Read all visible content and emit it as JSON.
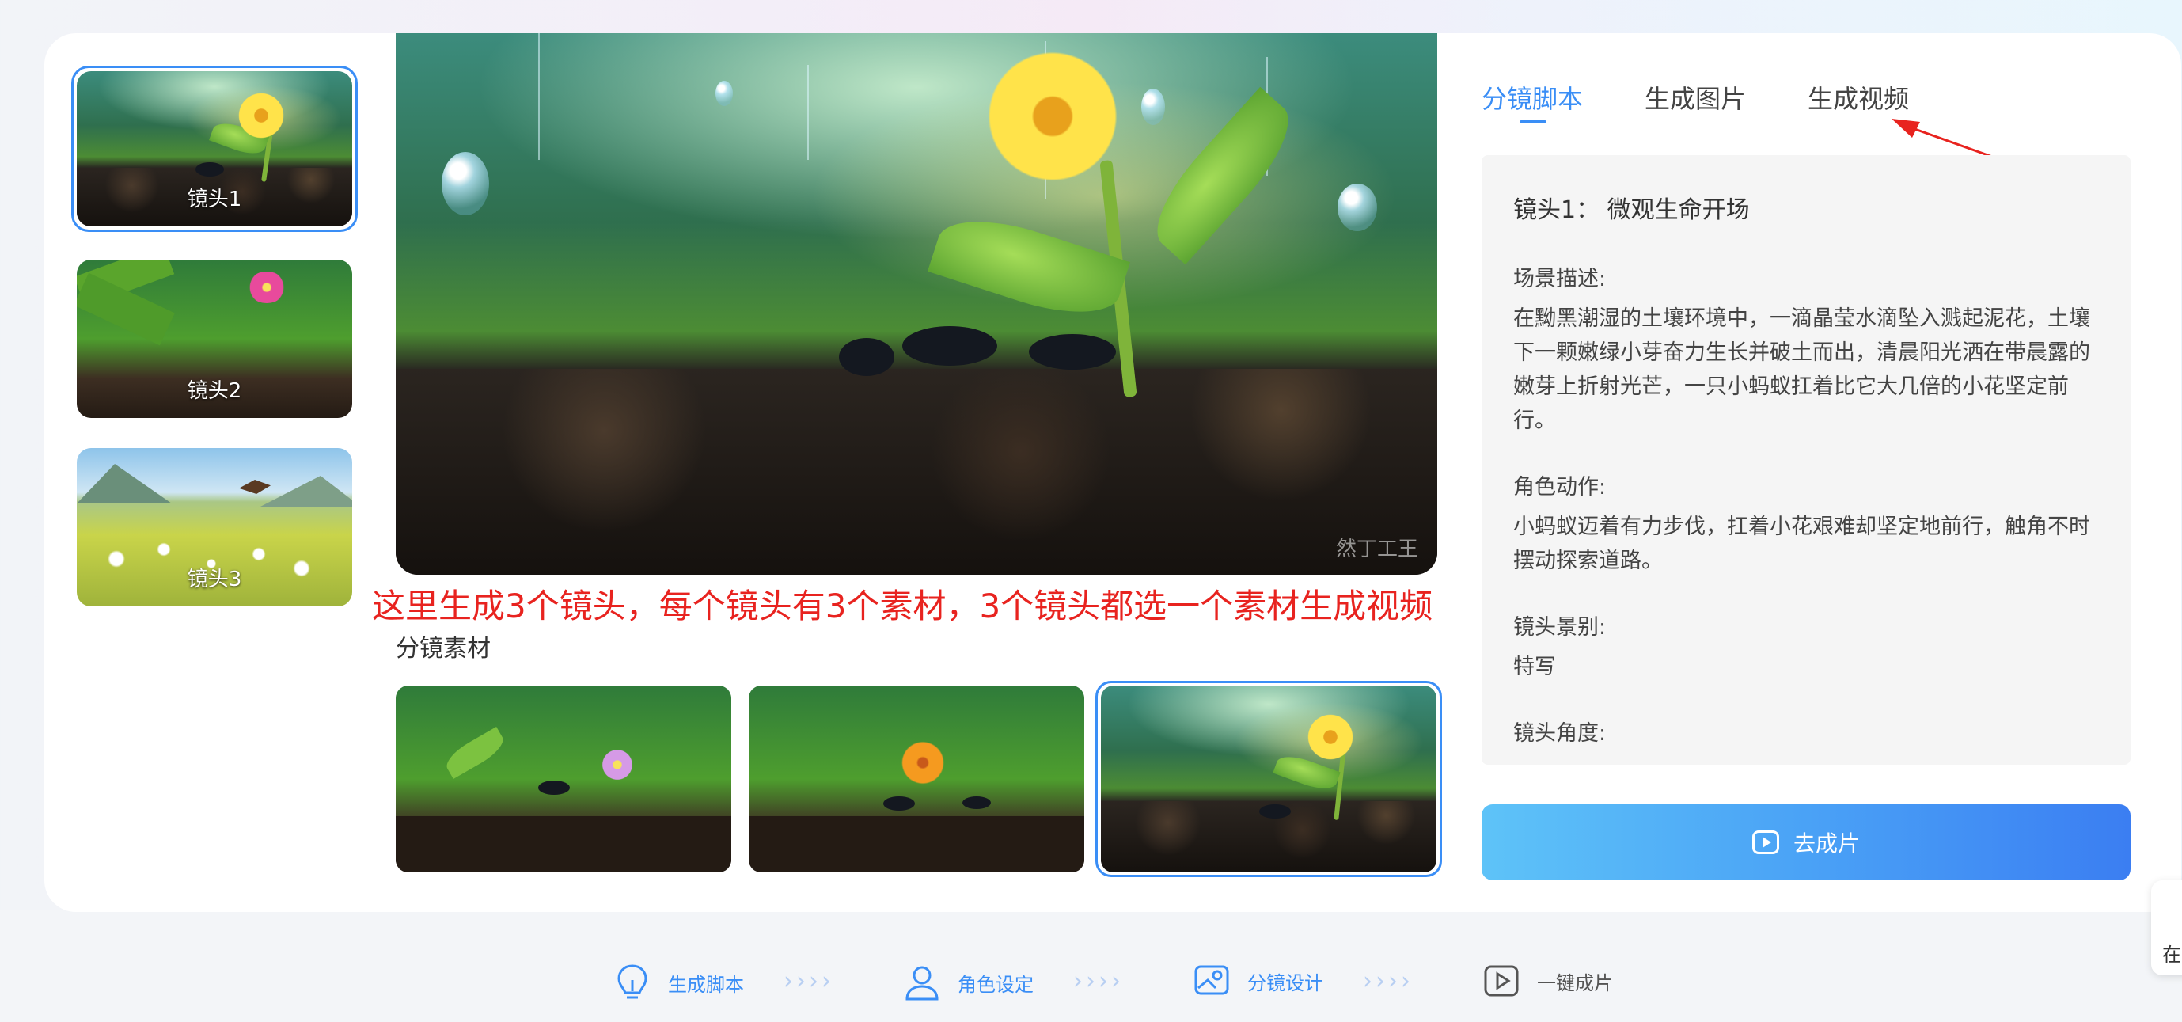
{
  "shots": [
    {
      "label": "镜头1",
      "selected": true
    },
    {
      "label": "镜头2",
      "selected": false
    },
    {
      "label": "镜头3",
      "selected": false
    }
  ],
  "preview": {
    "watermark": "然丁工王"
  },
  "annotation": "这里生成3个镜头，每个镜头有3个素材，3个镜头都选一个素材生成视频",
  "materials": {
    "title": "分镜素材",
    "items": [
      {
        "selected": false
      },
      {
        "selected": false
      },
      {
        "selected": true
      }
    ]
  },
  "tabs": [
    {
      "label": "分镜脚本",
      "active": true
    },
    {
      "label": "生成图片",
      "active": false
    },
    {
      "label": "生成视频",
      "active": false
    }
  ],
  "script": {
    "heading": "镜头1：  微观生命开场",
    "scene_label": "场景描述:",
    "scene_text": "在黝黑潮湿的土壤环境中，一滴晶莹水滴坠入溅起泥花，土壤下一颗嫩绿小芽奋力生长并破土而出，清晨阳光洒在带晨露的嫩芽上折射光芒，一只小蚂蚁扛着比它大几倍的小花坚定前行。",
    "action_label": "角色动作:",
    "action_text": "小蚂蚁迈着有力步伐，扛着小花艰难却坚定地前行，触角不时摆动探索道路。",
    "shot_size_label": "镜头景别:",
    "shot_size_text": "特写",
    "angle_label": "镜头角度:"
  },
  "go_button": {
    "label": "去成片",
    "icon": "play-square-icon"
  },
  "steps": [
    {
      "label": "生成脚本",
      "icon": "lightbulb-icon",
      "active": true
    },
    {
      "label": "角色设定",
      "icon": "user-icon",
      "active": true
    },
    {
      "label": "分镜设计",
      "icon": "storyboard-icon",
      "active": true
    },
    {
      "label": "一键成片",
      "icon": "play-square-icon",
      "active": false
    }
  ],
  "step_separator": "››››",
  "side_float_text": "在",
  "colors": {
    "accent": "#3a8ef6",
    "annotation": "#e8231f",
    "button_start": "#5ec3f8",
    "button_end": "#3b7ef2"
  }
}
